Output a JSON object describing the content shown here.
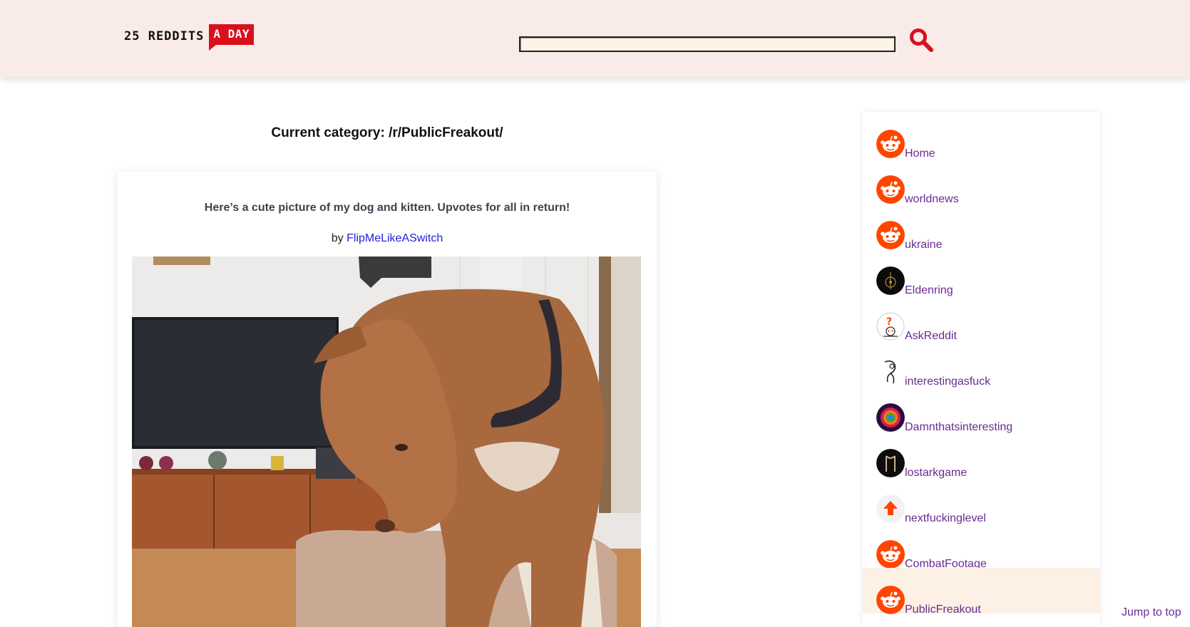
{
  "header": {
    "logo_main": "25 REDDITS",
    "logo_accent": "A DAY",
    "search_placeholder": "",
    "search_icon": "magnifier-icon",
    "accent_color": "#d90f1e",
    "background": "#f9ebe7"
  },
  "main": {
    "category_title": "Current category: /r/PublicFreakout/",
    "post": {
      "title": "Here’s a cute picture of my dog and kitten. Upvotes for all in return!",
      "by_label": "by",
      "author": "FlipMeLikeASwitch",
      "image": "dog-photo"
    }
  },
  "sidebar": {
    "items": [
      {
        "label": "Home",
        "icon": "reddit-snoo-icon",
        "active": false
      },
      {
        "label": "worldnews",
        "icon": "reddit-snoo-icon",
        "active": false
      },
      {
        "label": "ukraine",
        "icon": "reddit-snoo-icon",
        "active": false
      },
      {
        "label": "Eldenring",
        "icon": "eldenring-icon",
        "active": false
      },
      {
        "label": "AskReddit",
        "icon": "askreddit-icon",
        "active": false
      },
      {
        "label": "interestingasfuck",
        "icon": "interestingasfuck-icon",
        "active": false
      },
      {
        "label": "Damnthatsinteresting",
        "icon": "damnthatsinteresting-icon",
        "active": false
      },
      {
        "label": "lostarkgame",
        "icon": "lostarkgame-icon",
        "active": false
      },
      {
        "label": "nextfuckinglevel",
        "icon": "upvote-arrow-icon",
        "active": false
      },
      {
        "label": "CombatFootage",
        "icon": "reddit-snoo-icon",
        "active": false
      },
      {
        "label": "PublicFreakout",
        "icon": "reddit-snoo-icon",
        "active": true
      }
    ],
    "link_color": "#6a2b91",
    "active_background": "#fdf0e4"
  },
  "footer": {
    "jump_to_top": "Jump to top"
  }
}
